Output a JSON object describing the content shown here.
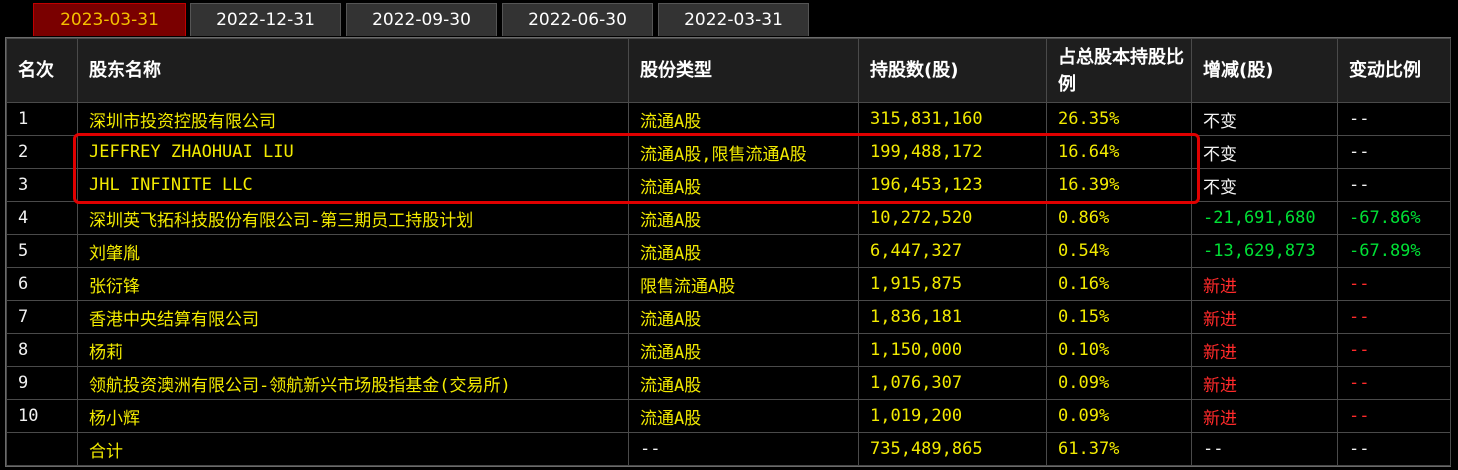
{
  "tabs": [
    {
      "label": "2023-03-31",
      "active": true
    },
    {
      "label": "2022-12-31",
      "active": false
    },
    {
      "label": "2022-09-30",
      "active": false
    },
    {
      "label": "2022-06-30",
      "active": false
    },
    {
      "label": "2022-03-31",
      "active": false
    }
  ],
  "table": {
    "headers": [
      "名次",
      "股东名称",
      "股份类型",
      "持股数(股)",
      "占总股本持股比例",
      "增减(股)",
      "变动比例"
    ],
    "rows": [
      {
        "rank": "1",
        "name": "深圳市投资控股有限公司",
        "type": "流通A股",
        "shares": "315,831,160",
        "pct": "26.35%",
        "change": "不变",
        "ratio": "--",
        "change_kind": "neutral"
      },
      {
        "rank": "2",
        "name": "JEFFREY ZHAOHUAI LIU",
        "type": "流通A股,限售流通A股",
        "shares": "199,488,172",
        "pct": "16.64%",
        "change": "不变",
        "ratio": "--",
        "change_kind": "neutral"
      },
      {
        "rank": "3",
        "name": "JHL INFINITE LLC",
        "type": "流通A股",
        "shares": "196,453,123",
        "pct": "16.39%",
        "change": "不变",
        "ratio": "--",
        "change_kind": "neutral"
      },
      {
        "rank": "4",
        "name": "深圳英飞拓科技股份有限公司-第三期员工持股计划",
        "type": "流通A股",
        "shares": "10,272,520",
        "pct": "0.86%",
        "change": "-21,691,680",
        "ratio": "-67.86%",
        "change_kind": "neg"
      },
      {
        "rank": "5",
        "name": "刘肇胤",
        "type": "流通A股",
        "shares": "6,447,327",
        "pct": "0.54%",
        "change": "-13,629,873",
        "ratio": "-67.89%",
        "change_kind": "neg"
      },
      {
        "rank": "6",
        "name": "张衍锋",
        "type": "限售流通A股",
        "shares": "1,915,875",
        "pct": "0.16%",
        "change": "新进",
        "ratio": "--",
        "change_kind": "up"
      },
      {
        "rank": "7",
        "name": "香港中央结算有限公司",
        "type": "流通A股",
        "shares": "1,836,181",
        "pct": "0.15%",
        "change": "新进",
        "ratio": "--",
        "change_kind": "up"
      },
      {
        "rank": "8",
        "name": "杨莉",
        "type": "流通A股",
        "shares": "1,150,000",
        "pct": "0.10%",
        "change": "新进",
        "ratio": "--",
        "change_kind": "up"
      },
      {
        "rank": "9",
        "name": "领航投资澳洲有限公司-领航新兴市场股指基金(交易所)",
        "type": "流通A股",
        "shares": "1,076,307",
        "pct": "0.09%",
        "change": "新进",
        "ratio": "--",
        "change_kind": "up"
      },
      {
        "rank": "10",
        "name": "杨小辉",
        "type": "流通A股",
        "shares": "1,019,200",
        "pct": "0.09%",
        "change": "新进",
        "ratio": "--",
        "change_kind": "up"
      }
    ],
    "total": {
      "rank": "",
      "name": "合计",
      "type": "--",
      "shares": "735,489,865",
      "pct": "61.37%",
      "change": "--",
      "ratio": "--"
    }
  },
  "colors": {
    "text": "#f2ea00",
    "negative": "#00e035",
    "positive": "#ff2a2a",
    "highlight": "#e00000",
    "active_tab": "#7a0000"
  }
}
